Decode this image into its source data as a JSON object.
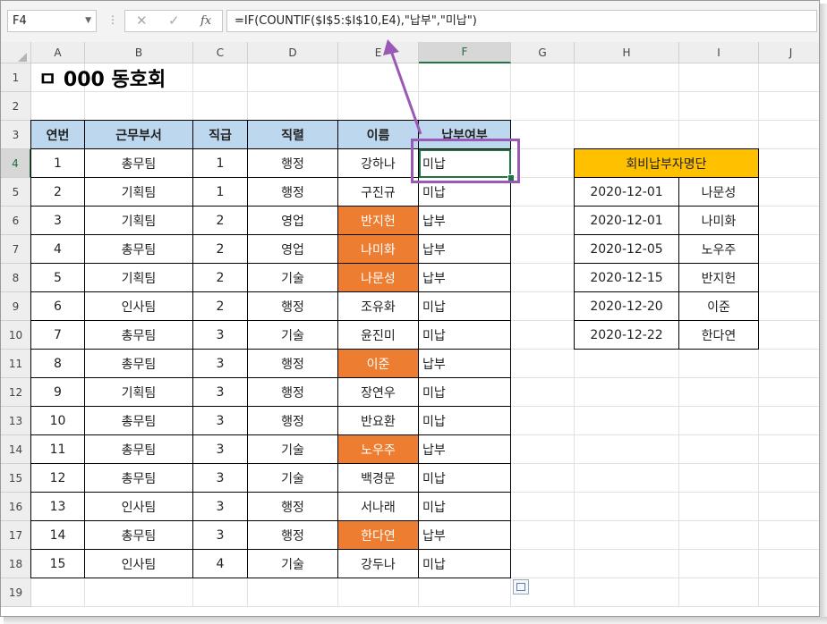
{
  "namebox": {
    "value": "F4"
  },
  "formula_bar": {
    "cancel_glyph": "✕",
    "enter_glyph": "✓",
    "fx_label": "fx",
    "formula": "=IF(COUNTIF($I$5:$I$10,E4),\"납부\",\"미납\")"
  },
  "columns": [
    "A",
    "B",
    "C",
    "D",
    "E",
    "F",
    "G",
    "H",
    "I",
    "J"
  ],
  "rows": [
    "1",
    "2",
    "3",
    "4",
    "5",
    "6",
    "7",
    "8",
    "9",
    "10",
    "11",
    "12",
    "13",
    "14",
    "15",
    "16",
    "17",
    "18",
    "19"
  ],
  "title": "ㅁ 000 동호회",
  "table": {
    "headers": [
      "연번",
      "근무부서",
      "직급",
      "직렬",
      "이름",
      "납부여부"
    ],
    "rows": [
      {
        "no": "1",
        "dept": "총무팀",
        "grade": "1",
        "series": "행정",
        "name": "강하나",
        "paid": "미납",
        "highlight": false
      },
      {
        "no": "2",
        "dept": "기획팀",
        "grade": "1",
        "series": "행정",
        "name": "구진규",
        "paid": "미납",
        "highlight": false
      },
      {
        "no": "3",
        "dept": "기획팀",
        "grade": "2",
        "series": "영업",
        "name": "반지헌",
        "paid": "납부",
        "highlight": true
      },
      {
        "no": "4",
        "dept": "총무팀",
        "grade": "2",
        "series": "영업",
        "name": "나미화",
        "paid": "납부",
        "highlight": true
      },
      {
        "no": "5",
        "dept": "기획팀",
        "grade": "2",
        "series": "기술",
        "name": "나문성",
        "paid": "납부",
        "highlight": true
      },
      {
        "no": "6",
        "dept": "인사팀",
        "grade": "2",
        "series": "행정",
        "name": "조유화",
        "paid": "미납",
        "highlight": false
      },
      {
        "no": "7",
        "dept": "총무팀",
        "grade": "3",
        "series": "기술",
        "name": "윤진미",
        "paid": "미납",
        "highlight": false
      },
      {
        "no": "8",
        "dept": "총무팀",
        "grade": "3",
        "series": "행정",
        "name": "이준",
        "paid": "납부",
        "highlight": true
      },
      {
        "no": "9",
        "dept": "기획팀",
        "grade": "3",
        "series": "행정",
        "name": "장연우",
        "paid": "미납",
        "highlight": false
      },
      {
        "no": "10",
        "dept": "총무팀",
        "grade": "3",
        "series": "행정",
        "name": "반요환",
        "paid": "미납",
        "highlight": false
      },
      {
        "no": "11",
        "dept": "총무팀",
        "grade": "3",
        "series": "기술",
        "name": "노우주",
        "paid": "납부",
        "highlight": true
      },
      {
        "no": "12",
        "dept": "총무팀",
        "grade": "3",
        "series": "기술",
        "name": "백경문",
        "paid": "미납",
        "highlight": false
      },
      {
        "no": "13",
        "dept": "인사팀",
        "grade": "3",
        "series": "행정",
        "name": "서나래",
        "paid": "미납",
        "highlight": false
      },
      {
        "no": "14",
        "dept": "총무팀",
        "grade": "3",
        "series": "행정",
        "name": "한다연",
        "paid": "납부",
        "highlight": true
      },
      {
        "no": "15",
        "dept": "인사팀",
        "grade": "4",
        "series": "기술",
        "name": "강두나",
        "paid": "미납",
        "highlight": false
      }
    ]
  },
  "side_table": {
    "title": "회비납부자명단",
    "rows": [
      {
        "date": "2020-12-01",
        "name": "나문성"
      },
      {
        "date": "2020-12-01",
        "name": "나미화"
      },
      {
        "date": "2020-12-05",
        "name": "노우주"
      },
      {
        "date": "2020-12-15",
        "name": "반지헌"
      },
      {
        "date": "2020-12-20",
        "name": "이준"
      },
      {
        "date": "2020-12-22",
        "name": "한다연"
      }
    ]
  },
  "colors": {
    "header_fill": "#bdd7ee",
    "highlight_fill": "#ed7d31",
    "side_title_fill": "#ffc000",
    "annotation": "#9b59b6",
    "selection": "#217346"
  }
}
